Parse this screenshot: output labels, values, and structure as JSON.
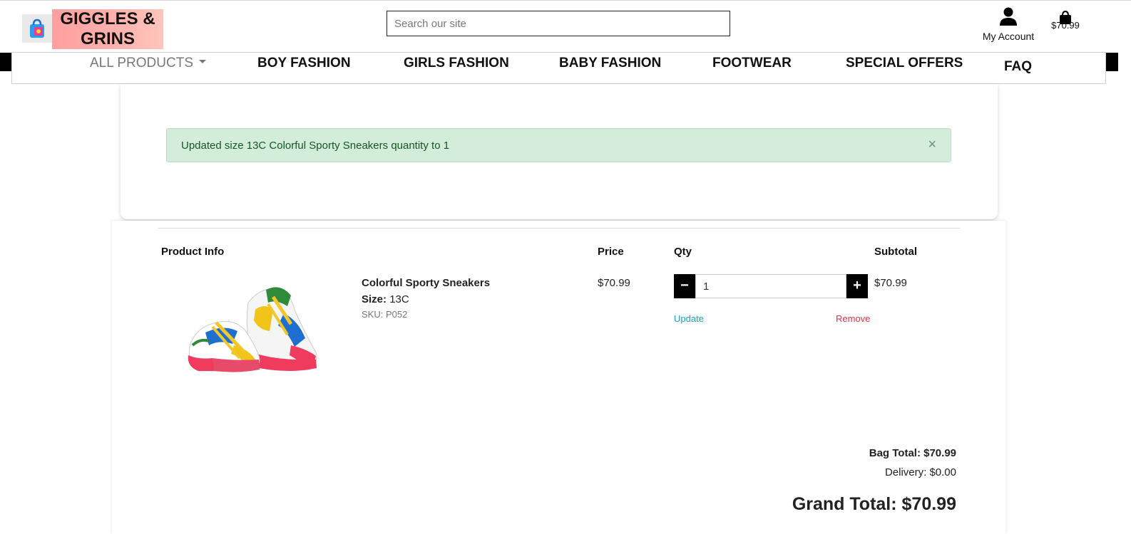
{
  "header": {
    "logo_text": "GIGGLES & GRINS",
    "search_placeholder": "Search our site",
    "account_label": "My Account",
    "bag_total": "$70.99"
  },
  "nav": {
    "items": [
      "ALL PRODUCTS",
      "BOY FASHION",
      "GIRLS FASHION",
      "BABY FASHION",
      "FOOTWEAR",
      "SPECIAL OFFERS",
      "FAQ"
    ]
  },
  "message": {
    "text": "Updated size 13C Colorful Sporty Sneakers quantity to 1",
    "close": "×"
  },
  "bag": {
    "headers": {
      "product": "Product Info",
      "price": "Price",
      "qty": "Qty",
      "subtotal": "Subtotal"
    },
    "item": {
      "name": "Colorful Sporty Sneakers",
      "size_label": "Size:",
      "size": "13C",
      "sku": "SKU: P052",
      "price": "$70.99",
      "quantity": "1",
      "subtotal": "$70.99",
      "update": "Update",
      "remove": "Remove",
      "minus": "−",
      "plus": "+"
    },
    "totals": {
      "bag_total": "Bag Total: $70.99",
      "delivery": "Delivery: $0.00",
      "grand_total": "Grand Total: $70.99"
    }
  },
  "colors": {
    "alert_bg": "#d4edda",
    "alert_text": "#155724",
    "update_link": "#17a2b8",
    "remove_link": "#dc3545"
  }
}
